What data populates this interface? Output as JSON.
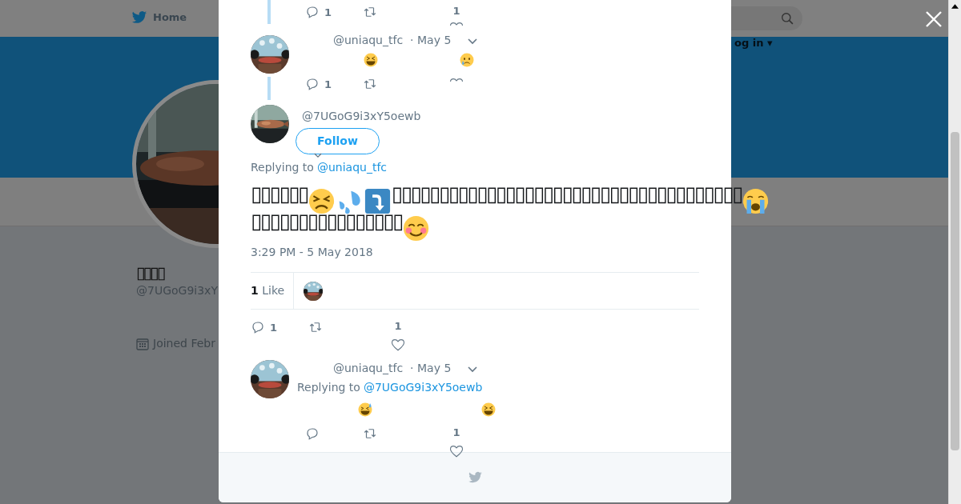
{
  "background": {
    "nav": {
      "home": "Home",
      "login": "og in ▾"
    },
    "profile": {
      "name": "▯▯▯▯",
      "handle": "@7UGoG9i3xY",
      "joined": "Joined Febr"
    }
  },
  "modal": {
    "top_tweet": {
      "reply_count": "1",
      "like_count": "1"
    },
    "thread_tweet": {
      "handle": "@uniaqu_tfc",
      "date": "· May 5",
      "emojis": [
        {
          "kind": "grin"
        },
        {
          "kind": "sad"
        }
      ],
      "reply_count": "1"
    },
    "main_tweet": {
      "handle": "@7UGoG9i3xY5oewb",
      "follow": "Follow",
      "replying_label": "Replying to",
      "replying_to": "@uniaqu_tfc",
      "lines": [
        [
          {
            "kind": "text",
            "text": "▯▯▯▯▯▯"
          },
          {
            "kind": "persevere"
          },
          {
            "kind": "sweat"
          },
          {
            "kind": "arrow"
          },
          {
            "kind": "text",
            "text": "▯▯▯▯▯▯▯▯▯▯▯▯▯▯▯▯▯▯▯▯▯▯▯▯▯▯▯▯▯▯▯▯▯▯▯▯▯"
          },
          {
            "kind": "cry"
          }
        ],
        [
          {
            "kind": "text",
            "text": "▯▯▯▯▯▯▯▯▯▯▯▯▯▯▯▯"
          },
          {
            "kind": "smile"
          }
        ]
      ],
      "time": "3:29 PM - 5 May 2018",
      "likes_count": "1",
      "likes_label": "Like",
      "reply_count": "1",
      "like_count": "1"
    },
    "reply_tweet": {
      "handle": "@uniaqu_tfc",
      "date": "· May 5",
      "replying_label": "Replying to",
      "replying_to": "@7UGoG9i3xY5oewb",
      "emojis": [
        {
          "kind": "sweatsmile"
        },
        {
          "kind": "grin"
        }
      ],
      "like_count": "1"
    }
  }
}
